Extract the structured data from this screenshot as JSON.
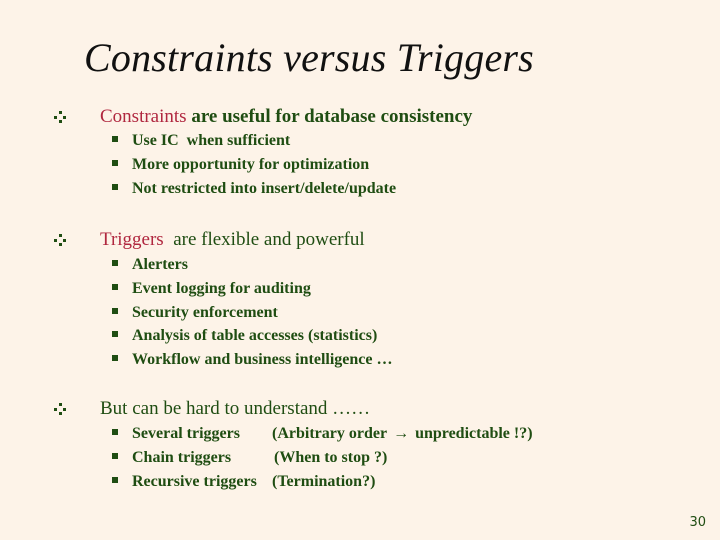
{
  "slide": {
    "title": "Constraints versus Triggers",
    "page_number": "30",
    "colors": {
      "background": "#fdf3e8",
      "text": "#1f4d12",
      "highlight": "#b0273f",
      "title": "#111111"
    },
    "sections": [
      {
        "highlight": "Constraints",
        "rest": " are useful for database consistency",
        "items": [
          "Use IC  when sufficient",
          "More opportunity for optimization",
          "Not restricted into insert/delete/update"
        ]
      },
      {
        "highlight": "Triggers",
        "rest": "  are flexible and powerful",
        "items": [
          "Alerters",
          "Event logging for auditing",
          "Security enforcement",
          "Analysis of table accesses (statistics)",
          "Workflow and business intelligence …"
        ]
      },
      {
        "highlight": "",
        "rest": "But can be hard to understand ……",
        "items": [
          {
            "label": "Several triggers",
            "note_before": "(Arbitrary order",
            "arrow": "→",
            "note_after": "unpredictable !?)"
          },
          {
            "label": "Chain triggers",
            "note": "(When to stop ?)"
          },
          {
            "label": "Recursive triggers",
            "note": "(Termination?)"
          }
        ]
      }
    ]
  }
}
